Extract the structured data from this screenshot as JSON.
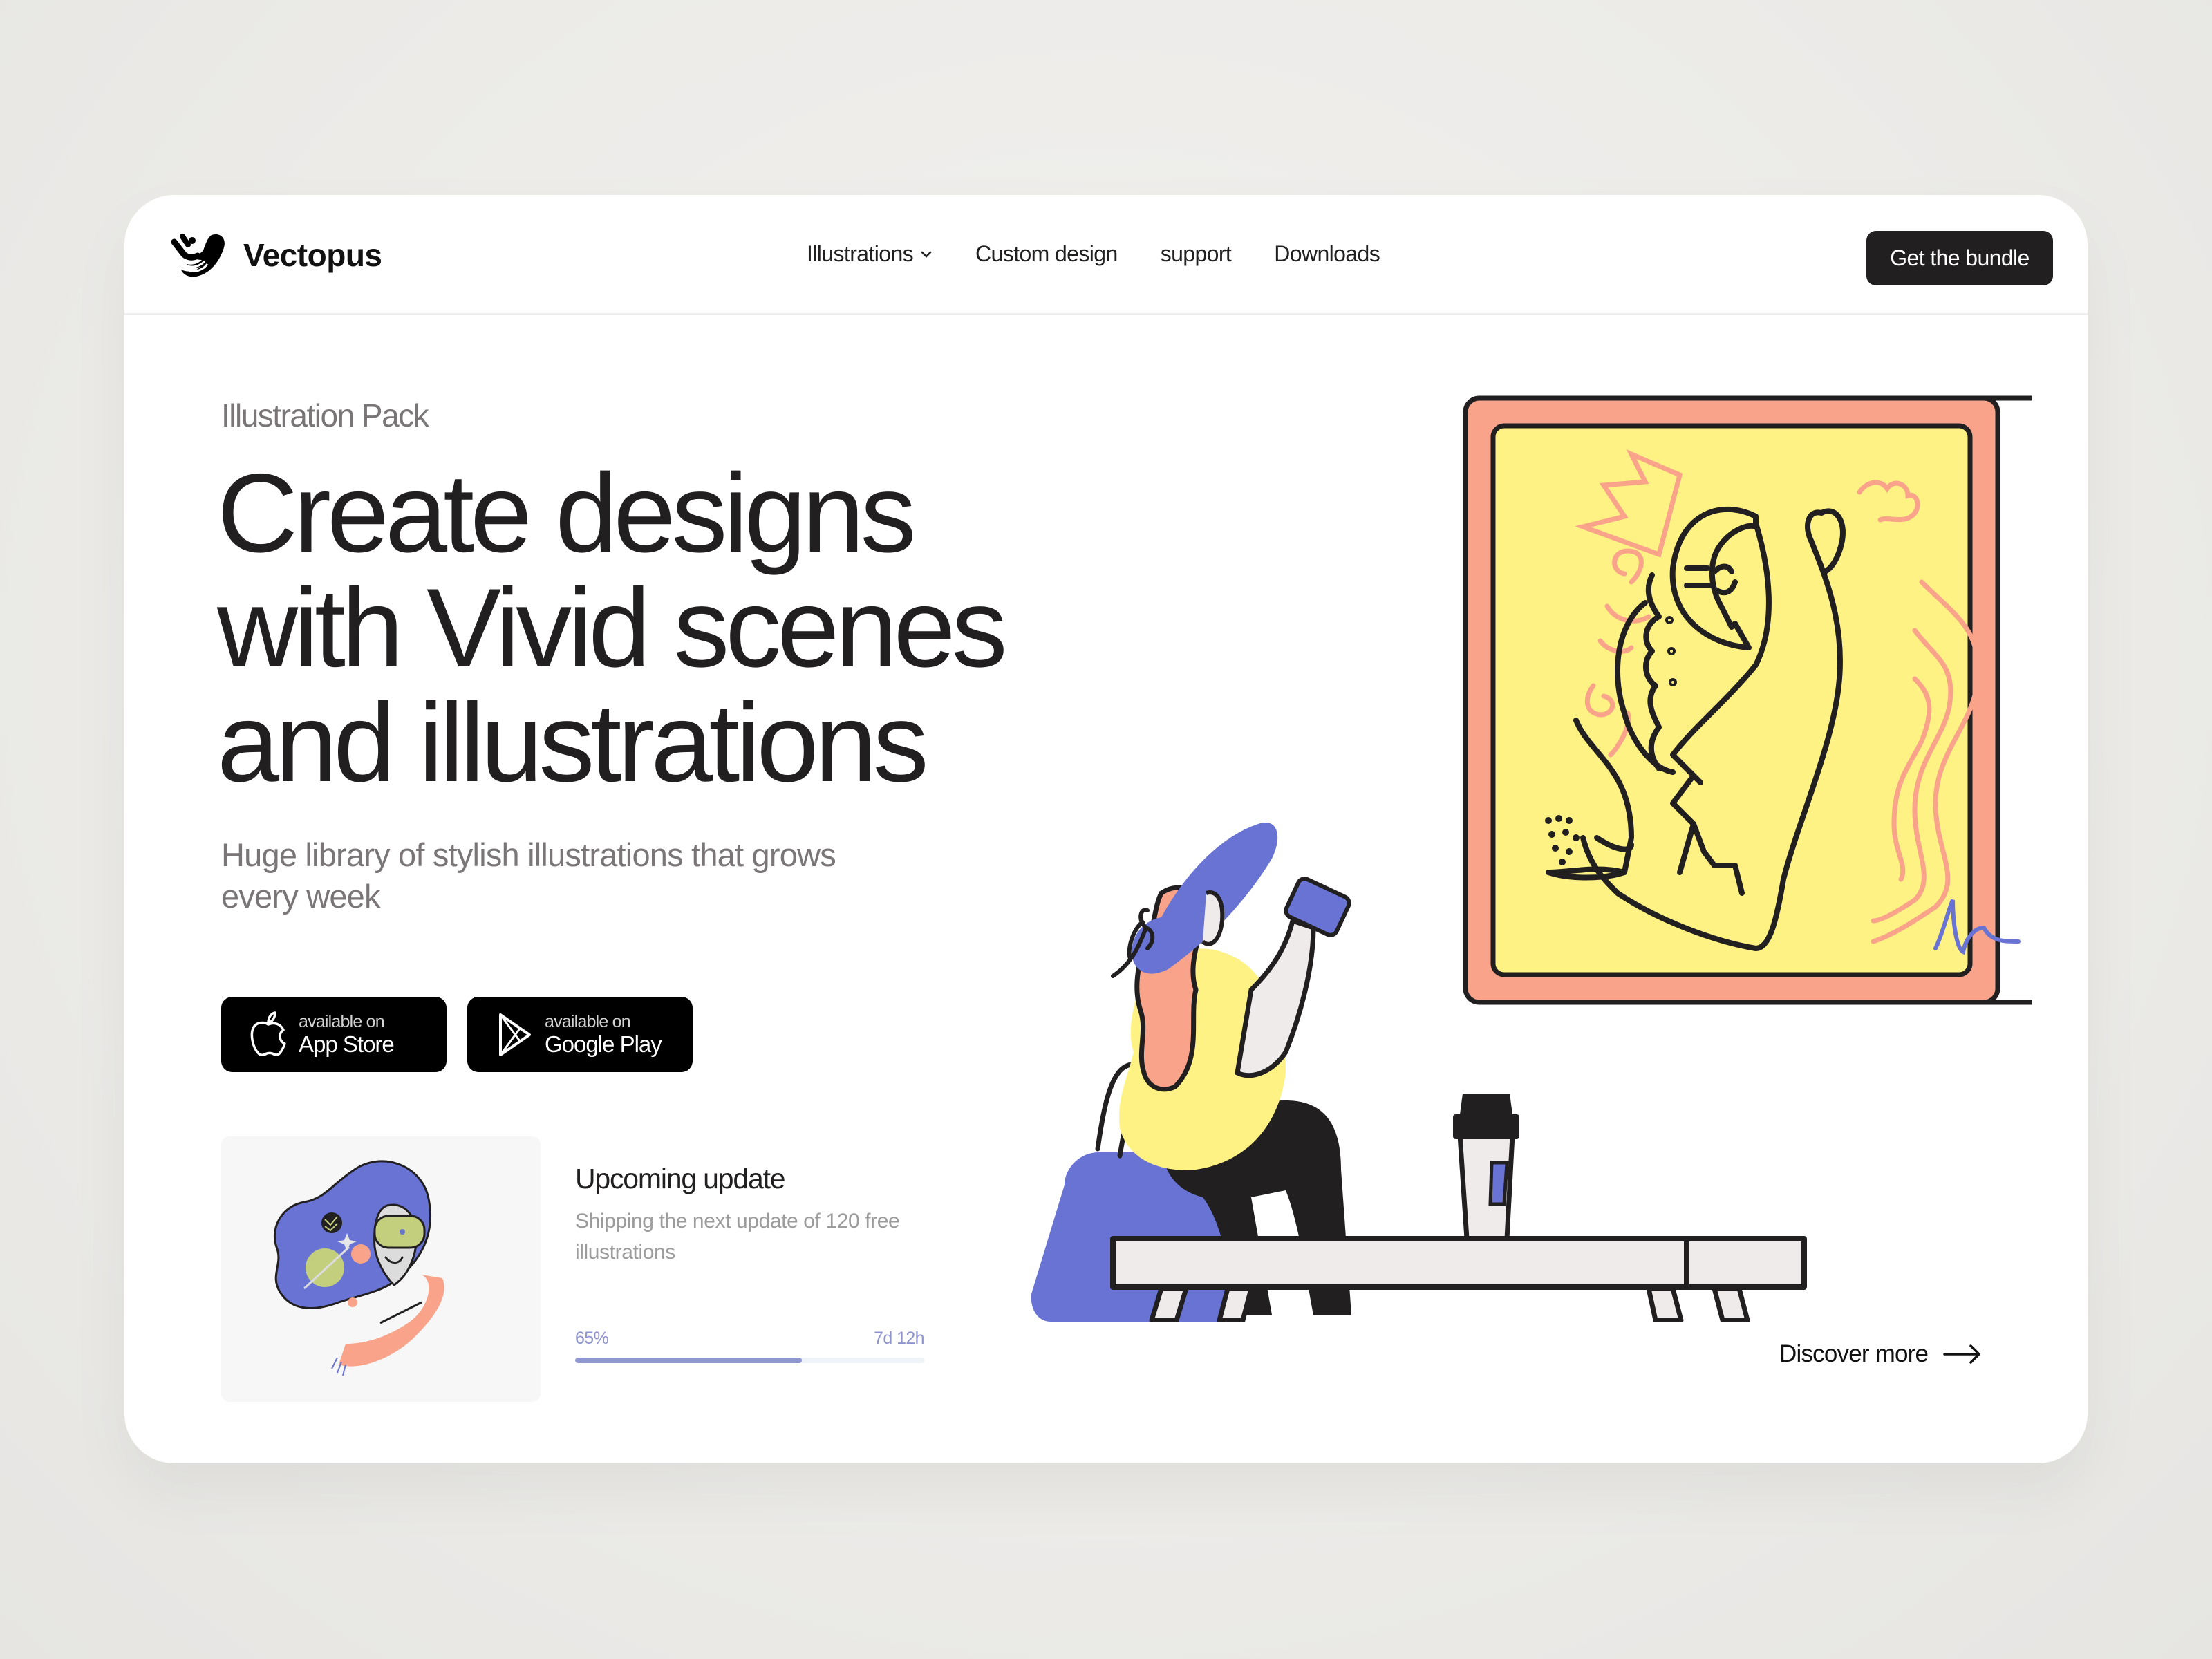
{
  "brand": {
    "name": "Vectopus",
    "logo_icon": "vectopus-hand-logo-icon"
  },
  "nav": {
    "items": [
      {
        "label": "Illustrations",
        "has_dropdown": true,
        "icon": "chevron-down-icon"
      },
      {
        "label": "Custom design"
      },
      {
        "label": "support"
      },
      {
        "label": "Downloads"
      }
    ],
    "cta_label": "Get the bundle"
  },
  "hero": {
    "eyebrow": "Illustration Pack",
    "headline_lines": [
      "Create designs",
      "with Vivid scenes",
      "and illustrations"
    ],
    "subtitle": "Huge library of stylish illustrations that grows every week",
    "store_buttons": [
      {
        "small": "available on",
        "big": "App Store",
        "icon": "apple-icon"
      },
      {
        "small": "available on",
        "big": "Google Play",
        "icon": "google-play-icon"
      }
    ],
    "illustration": "woman-on-bench-viewing-painting-illustration"
  },
  "update": {
    "title": "Upcoming update",
    "description": "Shipping the next update of 120 free illustrations",
    "progress_label": "65%",
    "progress_value": 0.65,
    "time_left": "7d 12h",
    "thumbnail": "dreaming-girl-with-vr-headset-illustration"
  },
  "discover": {
    "label": "Discover more",
    "icon": "arrow-right-icon"
  },
  "colors": {
    "ink": "#221f20",
    "muted": "#7a7677",
    "accent_blue": "#6873d3",
    "accent_yellow": "#fff284",
    "accent_salmon": "#f8a38a",
    "progress_fill": "#8f96d2",
    "progress_track": "#edf3f7"
  }
}
